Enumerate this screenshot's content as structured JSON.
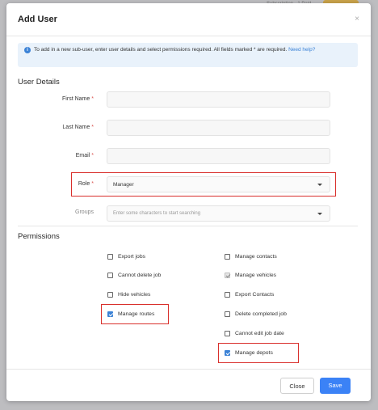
{
  "background": {
    "top_text": "Subscription · 1 Paid"
  },
  "modal": {
    "title": "Add User",
    "close_glyph": "×"
  },
  "info": {
    "text": "To add in a new sub-user, enter user details and select permissions required. All fields marked * are required.",
    "link": "Need help?"
  },
  "user_details": {
    "heading": "User Details",
    "fields": {
      "first_name": {
        "label": "First Name",
        "value": ""
      },
      "last_name": {
        "label": "Last Name",
        "value": ""
      },
      "email": {
        "label": "Email",
        "value": ""
      },
      "role": {
        "label": "Role",
        "value": "Manager"
      },
      "groups": {
        "label": "Groups",
        "placeholder": "Enter some characters to start searching"
      }
    },
    "required_mark": "*"
  },
  "permissions": {
    "heading": "Permissions",
    "left": [
      {
        "label": "Export jobs",
        "checked": false
      },
      {
        "label": "Cannot delete job",
        "checked": false
      },
      {
        "label": "Hide vehicles",
        "checked": false
      },
      {
        "label": "Manage routes",
        "checked": true
      }
    ],
    "right": [
      {
        "label": "Manage contacts",
        "checked": false
      },
      {
        "label": "Manage vehicles",
        "checked": true,
        "disabled": true
      },
      {
        "label": "Export Contacts",
        "checked": false
      },
      {
        "label": "Delete completed job",
        "checked": false
      },
      {
        "label": "Cannot edit job date",
        "checked": false
      },
      {
        "label": "Manage depots",
        "checked": true
      }
    ]
  },
  "footer": {
    "close_label": "Close",
    "save_label": "Save"
  },
  "colors": {
    "accent": "#3b82f6",
    "highlight": "#d9302c",
    "info_bg": "#e9f2fb"
  }
}
